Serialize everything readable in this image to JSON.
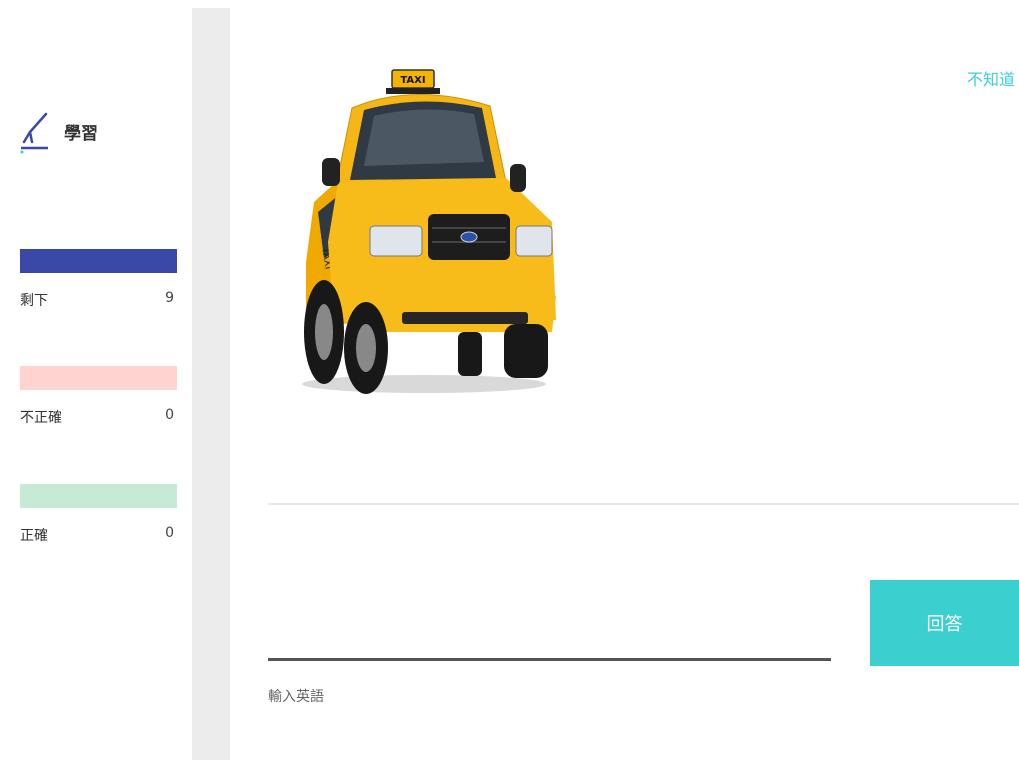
{
  "sidebar": {
    "mode_label": "學習",
    "stats": [
      {
        "label": "剩下",
        "value": "9",
        "color": "#3a49a8"
      },
      {
        "label": "不正確",
        "value": "0",
        "color": "#ffd4d0"
      },
      {
        "label": "正確",
        "value": "0",
        "color": "#c6ead6"
      }
    ]
  },
  "main": {
    "dont_know": "不知道",
    "input_label": "輸入英語",
    "answer_button": "回答"
  },
  "colors": {
    "accent": "#3ccfcf",
    "remaining": "#3a49a8",
    "incorrect": "#ffd4d0",
    "correct": "#c6ead6"
  },
  "icons": {
    "mode": "pen-icon",
    "image": "taxi-image"
  }
}
